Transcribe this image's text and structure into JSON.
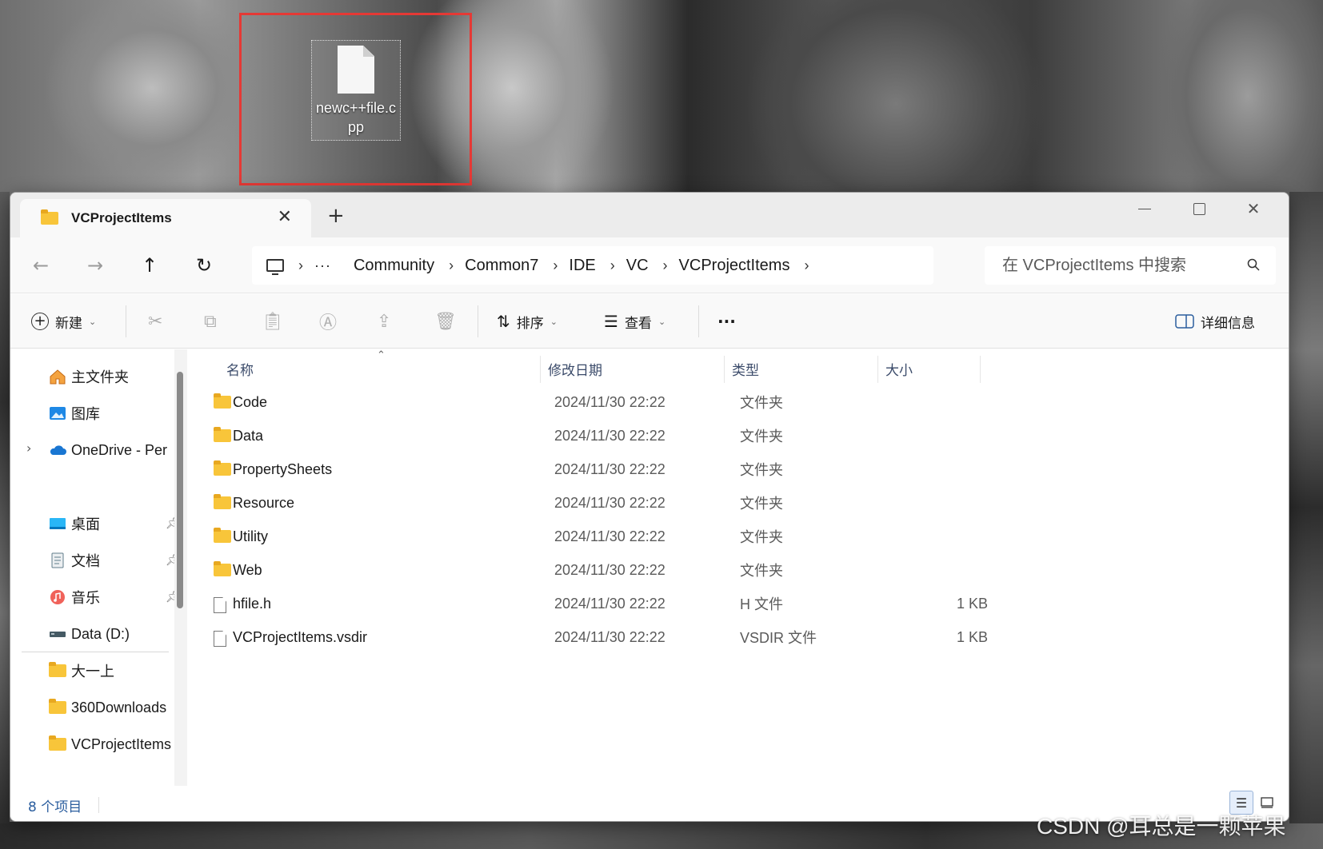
{
  "desktop": {
    "file_label": "newc++file.cpp"
  },
  "window": {
    "tab_title": "VCProjectItems",
    "new_tab": "+",
    "close_tab": "✕"
  },
  "address": {
    "ellipsis": "···",
    "crumbs": [
      "Community",
      "Common7",
      "IDE",
      "VC",
      "VCProjectItems"
    ],
    "separator": "›"
  },
  "search": {
    "placeholder": "在 VCProjectItems 中搜索"
  },
  "toolbar": {
    "new_label": "新建",
    "sort_label": "排序",
    "view_label": "查看",
    "more_label": "···",
    "details_label": "详细信息"
  },
  "sidebar": {
    "items": [
      {
        "label": "主文件夹",
        "icon": "home-icon"
      },
      {
        "label": "图库",
        "icon": "gallery-icon"
      },
      {
        "label": "OneDrive - Per",
        "icon": "onedrive-icon"
      },
      {
        "label": "桌面",
        "icon": "desktop-icon",
        "pinned": true
      },
      {
        "label": "文档",
        "icon": "documents-icon",
        "pinned": true
      },
      {
        "label": "音乐",
        "icon": "music-icon",
        "pinned": true
      },
      {
        "label": "Data (D:)",
        "icon": "drive-icon"
      },
      {
        "label": "大一上",
        "icon": "folder-icon"
      },
      {
        "label": "360Downloads",
        "icon": "folder-icon"
      },
      {
        "label": "VCProjectItems",
        "icon": "folder-icon"
      }
    ]
  },
  "columns": {
    "name": "名称",
    "date": "修改日期",
    "type": "类型",
    "size": "大小"
  },
  "files": [
    {
      "name": "Code",
      "date": "2024/11/30 22:22",
      "type": "文件夹",
      "size": "",
      "kind": "folder"
    },
    {
      "name": "Data",
      "date": "2024/11/30 22:22",
      "type": "文件夹",
      "size": "",
      "kind": "folder"
    },
    {
      "name": "PropertySheets",
      "date": "2024/11/30 22:22",
      "type": "文件夹",
      "size": "",
      "kind": "folder"
    },
    {
      "name": "Resource",
      "date": "2024/11/30 22:22",
      "type": "文件夹",
      "size": "",
      "kind": "folder"
    },
    {
      "name": "Utility",
      "date": "2024/11/30 22:22",
      "type": "文件夹",
      "size": "",
      "kind": "folder"
    },
    {
      "name": "Web",
      "date": "2024/11/30 22:22",
      "type": "文件夹",
      "size": "",
      "kind": "folder"
    },
    {
      "name": "hfile.h",
      "date": "2024/11/30 22:22",
      "type": "H 文件",
      "size": "1 KB",
      "kind": "file"
    },
    {
      "name": "VCProjectItems.vsdir",
      "date": "2024/11/30 22:22",
      "type": "VSDIR 文件",
      "size": "1 KB",
      "kind": "file"
    }
  ],
  "status": {
    "item_count": "8 个项目"
  },
  "watermark": "CSDN @耳总是一颗苹果",
  "colors": {
    "highlight_border": "#e53935",
    "folder_yellow": "#f8c53a",
    "status_blue": "#2a5d9e"
  }
}
